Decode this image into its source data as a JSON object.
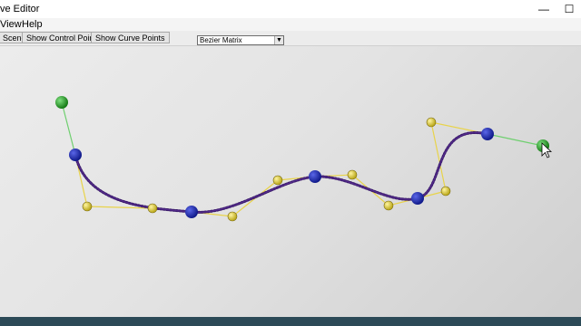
{
  "window": {
    "title": "ve Editor",
    "minimize": "—",
    "maximize": "☐"
  },
  "menu": {
    "items": [
      "View",
      "Help"
    ]
  },
  "toolbar": {
    "buttons": [
      "Scene",
      "Show Control Points",
      "Show Curve Points"
    ],
    "matrix_select": "Bezier Matrix"
  },
  "colors": {
    "curve": "#3a1a6b",
    "control_line": "#e8d34a",
    "tangent_line": "#6fcf6f",
    "anchor_point": "#1a22a0",
    "control_point": "#d6c52a",
    "endpoint_handle": "#1e8a1e"
  }
}
